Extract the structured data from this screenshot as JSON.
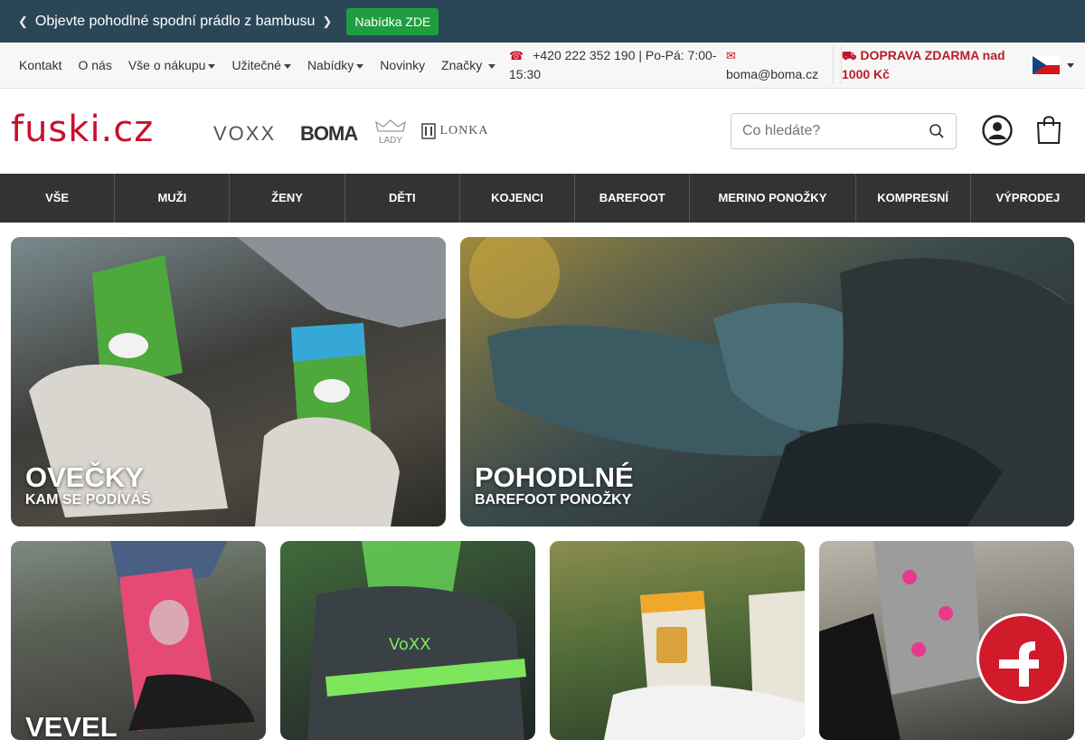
{
  "announcement": {
    "text": "Objevte pohodlné spodní prádlo z bambusu",
    "button": "Nabídka ZDE",
    "left_chevron": "chevron-left-icon",
    "right_chevron": "chevron-right-icon"
  },
  "subnav": {
    "items": [
      "Kontakt",
      "O nás",
      "Vše o nákupu",
      "Užitečné",
      "Nabídky",
      "Novinky",
      "Značky"
    ],
    "phone": "+420 222 352 190 | Po-Pá: 7:00-15:30",
    "email": "boma@boma.cz",
    "shipping": "DOPRAVA ZDARMA nad 1000 Kč"
  },
  "header": {
    "logo": "fuski.cz",
    "brands": [
      "VOXX",
      "BOMA",
      "LADY",
      "LONKA"
    ],
    "search_placeholder": "Co hledáte?"
  },
  "categories": [
    "VŠE",
    "MUŽI",
    "ŽENY",
    "DĚTI",
    "KOJENCI",
    "BAREFOOT",
    "MERINO PONOŽKY",
    "KOMPRESNÍ",
    "VÝPRODEJ"
  ],
  "banners": [
    {
      "title": "OVEČKY",
      "subtitle": "KAM SE PODÍVÁŠ"
    },
    {
      "title": "POHODLNÉ",
      "subtitle": "BAREFOOT PONOŽKY"
    }
  ],
  "small_banners": [
    {
      "title": "VEVEL"
    }
  ],
  "colors": {
    "announce_bg": "#2b4757",
    "accent_red": "#c8102e",
    "button_green": "#1e9e3e",
    "catnav_bg": "#333333"
  }
}
